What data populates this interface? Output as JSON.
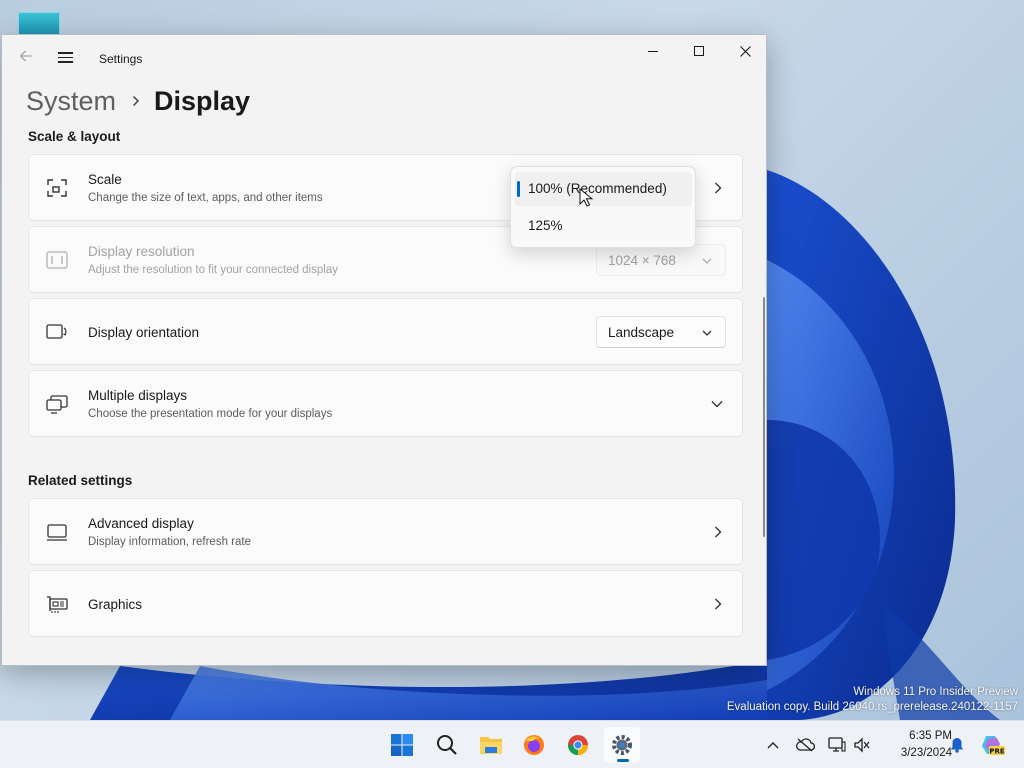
{
  "window": {
    "title": "Settings",
    "controls": {
      "minimize": "minimize",
      "maximize": "maximize",
      "close": "close"
    }
  },
  "breadcrumb": {
    "parent": "System",
    "current": "Display"
  },
  "sections": {
    "scale_layout": "Scale & layout",
    "related": "Related settings"
  },
  "cards": {
    "scale": {
      "title": "Scale",
      "subtitle": "Change the size of text, apps, and other items",
      "icon": "scale-icon"
    },
    "resolution": {
      "title": "Display resolution",
      "subtitle": "Adjust the resolution to fit your connected display",
      "value": "1024 × 768",
      "icon": "resolution-icon",
      "disabled": true
    },
    "orientation": {
      "title": "Display orientation",
      "value": "Landscape",
      "icon": "orientation-icon"
    },
    "multiple": {
      "title": "Multiple displays",
      "subtitle": "Choose the presentation mode for your displays",
      "icon": "multiple-displays-icon"
    },
    "advanced": {
      "title": "Advanced display",
      "subtitle": "Display information, refresh rate",
      "icon": "monitor-icon"
    },
    "graphics": {
      "title": "Graphics",
      "icon": "graphics-card-icon"
    }
  },
  "scale_dropdown": {
    "options": [
      "100% (Recommended)",
      "125%"
    ],
    "selected": "100% (Recommended)"
  },
  "desktop": {
    "watermark_line1": "Windows 11 Pro Insider Preview",
    "watermark_line2": "Evaluation copy. Build 26040.rs_prerelease.240122-1157"
  },
  "taskbar": {
    "apps": [
      "start-icon",
      "search-icon",
      "file-explorer-icon",
      "firefox-icon",
      "chrome-icon",
      "settings-icon"
    ],
    "tray_icons": [
      "chevron-up-icon",
      "onedrive-icon",
      "network-icon",
      "volume-icon",
      "notification-bell-icon",
      "copilot-icon"
    ],
    "copilot_badge": "PRE",
    "time": "6:35 PM",
    "date": "3/23/2024"
  },
  "colors": {
    "accent": "#0067c0",
    "window_bg": "#f3f3f3",
    "card_bg": "#fbfbfb"
  }
}
